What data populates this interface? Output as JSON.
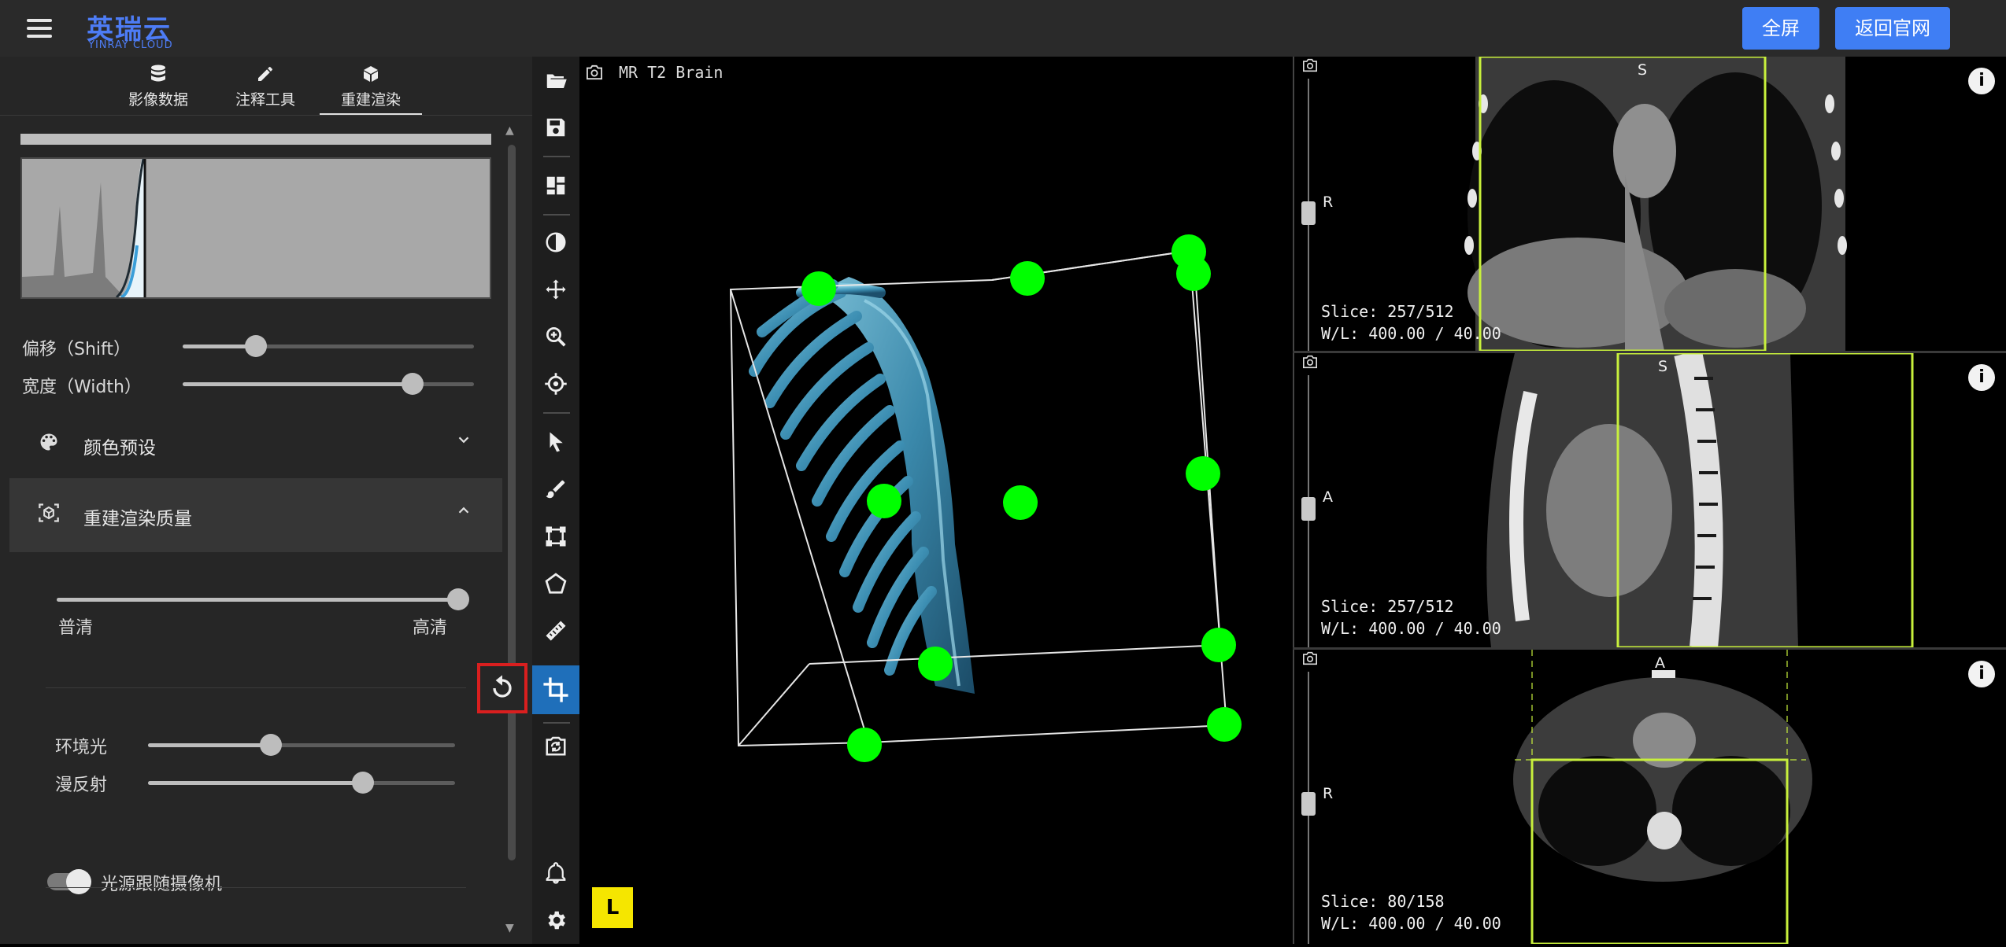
{
  "header": {
    "logo_cn": "英瑞云",
    "logo_en": "YINRAY CLOUD",
    "btn_fullscreen": "全屏",
    "btn_home": "返回官网"
  },
  "tabs": [
    {
      "label": "影像数据",
      "icon": "database-icon"
    },
    {
      "label": "注释工具",
      "icon": "pencil-icon"
    },
    {
      "label": "重建渲染",
      "icon": "cube-icon"
    }
  ],
  "tabs_active": "重建渲染",
  "sliders": {
    "shift": {
      "label": "偏移（Shift）",
      "value": 0.25
    },
    "width": {
      "label": "宽度（Width）",
      "value": 0.79
    },
    "quality": {
      "low": "普清",
      "high": "高清",
      "value": 1.0
    },
    "ambient": {
      "label": "环境光",
      "value": 0.4
    },
    "diffuse": {
      "label": "漫反射",
      "value": 0.7
    }
  },
  "accordions": {
    "color_preset": {
      "title": "颜色预设",
      "icon": "palette-icon",
      "expanded": false
    },
    "quality": {
      "title": "重建渲染质量",
      "icon": "cube-scan-icon",
      "expanded": true
    }
  },
  "light_follow_camera": {
    "label": "光源跟随摄像机",
    "enabled": true
  },
  "reset_icon": "reset-icon",
  "toolbar": [
    "folder-open-icon",
    "save-icon",
    "layout-icon",
    "contrast-icon",
    "move-icon",
    "zoom-icon",
    "crosshair-icon",
    "pointer-icon",
    "brush-icon",
    "bounding-box-icon",
    "polygon-icon",
    "ruler-icon",
    "crop-icon",
    "camera-reset-icon",
    "bell-icon",
    "gear-icon"
  ],
  "toolbar_active": "crop-icon",
  "main_viewport": {
    "label": "MR T2 Brain",
    "orientation": "L"
  },
  "viewports": [
    {
      "slice": "Slice: 257/512",
      "wl": "W/L: 400.00 / 40.00",
      "top": "S",
      "left": "R"
    },
    {
      "slice": "Slice: 257/512",
      "wl": "W/L: 400.00 / 40.00",
      "top": "S",
      "left": "A"
    },
    {
      "slice": "Slice: 80/158",
      "wl": "W/L: 400.00 / 40.00",
      "top": "A",
      "left": "R"
    }
  ],
  "colors": {
    "accent": "#3f7ef4",
    "handle": "#00ff00",
    "highlight_box": "#c8f03c",
    "active_tool": "#1f6fba"
  }
}
